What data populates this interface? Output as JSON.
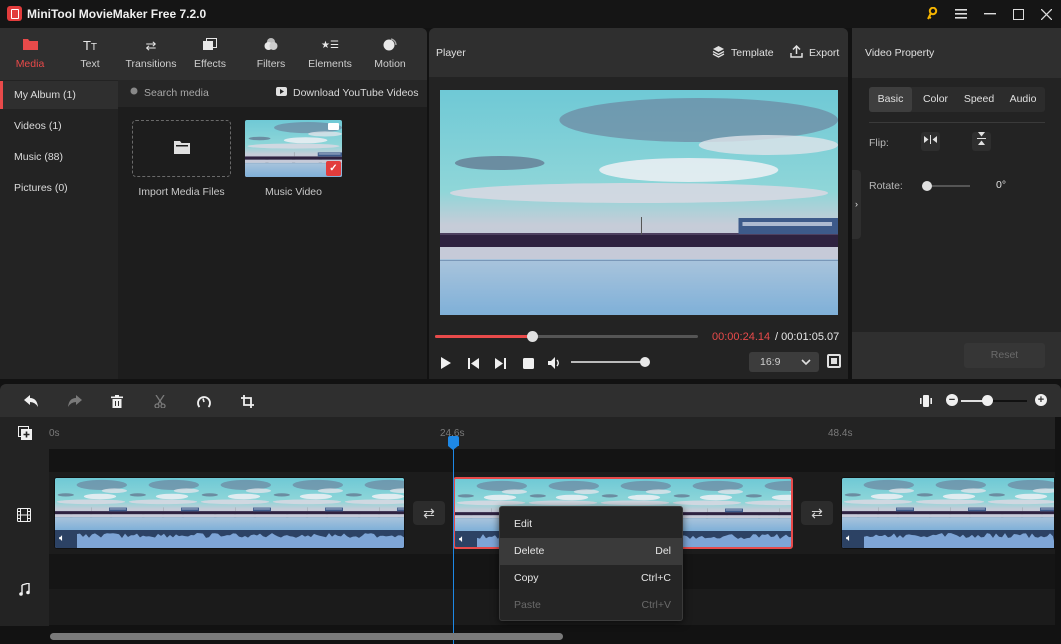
{
  "app": {
    "title": "MiniTool MovieMaker Free 7.2.0"
  },
  "window_controls": {
    "key": "key-icon",
    "menu": "menu-icon",
    "minimize": "minimize-icon",
    "maximize": "maximize-icon",
    "close": "close-icon"
  },
  "media_tabs": [
    {
      "label": "Media",
      "icon": "folder-icon",
      "active": true
    },
    {
      "label": "Text",
      "icon": "text-icon"
    },
    {
      "label": "Transitions",
      "icon": "transitions-icon"
    },
    {
      "label": "Effects",
      "icon": "effects-icon"
    },
    {
      "label": "Filters",
      "icon": "filters-icon"
    },
    {
      "label": "Elements",
      "icon": "elements-icon"
    },
    {
      "label": "Motion",
      "icon": "motion-icon"
    }
  ],
  "media_sidebar": [
    {
      "label": "My Album (1)",
      "active": true
    },
    {
      "label": "Videos (1)"
    },
    {
      "label": "Music (88)"
    },
    {
      "label": "Pictures (0)"
    }
  ],
  "media_content": {
    "search_placeholder": "Search media",
    "download_label": "Download YouTube Videos",
    "items": [
      {
        "label": "Import Media Files",
        "type": "import"
      },
      {
        "label": "Music Video",
        "type": "video",
        "selected": true
      }
    ]
  },
  "player": {
    "title": "Player",
    "template_label": "Template",
    "export_label": "Export",
    "time_current": "00:00:24.14",
    "time_total": " / 00:01:05.07",
    "progress_fraction": 0.37,
    "volume_fraction": 1.0,
    "aspect_ratio": "16:9"
  },
  "property": {
    "title": "Video Property",
    "tabs": [
      "Basic",
      "Color",
      "Speed",
      "Audio"
    ],
    "active_tab": "Basic",
    "flip_label": "Flip:",
    "rotate_label": "Rotate:",
    "rotate_value": "0°",
    "rotate_fraction": 0,
    "reset_label": "Reset"
  },
  "timeline": {
    "ruler": [
      "0s",
      "24.6s",
      "48.4s"
    ],
    "zoom_fraction": 0.4,
    "clips": [
      {
        "name": "clip-1",
        "selected": false
      },
      {
        "name": "clip-2",
        "selected": true
      },
      {
        "name": "clip-3",
        "selected": false
      }
    ]
  },
  "context_menu": {
    "items": [
      {
        "label": "Edit",
        "shortcut": ""
      },
      {
        "label": "Delete",
        "shortcut": "Del",
        "hover": true
      },
      {
        "label": "Copy",
        "shortcut": "Ctrl+C"
      },
      {
        "label": "Paste",
        "shortcut": "Ctrl+V",
        "disabled": true
      }
    ]
  },
  "colors": {
    "accent": "#e84a4a",
    "playhead": "#1e88e5",
    "key": "#f5b400"
  }
}
